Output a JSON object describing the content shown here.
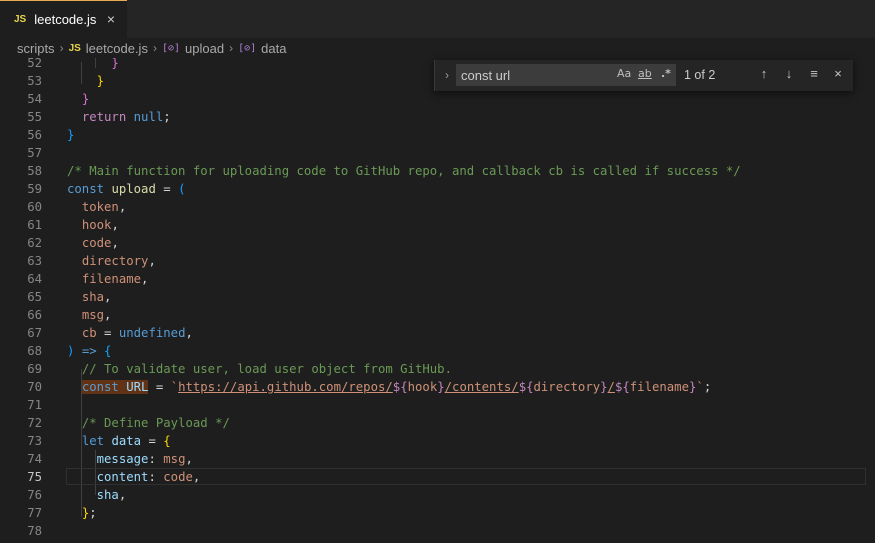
{
  "tab": {
    "badge": "JS",
    "label": "leetcode.js",
    "close": "×"
  },
  "breadcrumb": {
    "folder": "scripts",
    "file_badge": "JS",
    "file": "leetcode.js",
    "sym_icon": "[⊘]",
    "symbol1": "upload",
    "symbol2": "data",
    "sep": "›"
  },
  "find": {
    "toggle": "›",
    "query": "const url",
    "match_case": "Aa",
    "whole_word": "ab",
    "regex": ".*",
    "count": "1 of 2",
    "prev": "↑",
    "next": "↓",
    "selection": "≡",
    "close": "×"
  },
  "editor": {
    "active_line": "75",
    "lines": [
      {
        "n": "52",
        "tokens": [
          {
            "t": "      "
          },
          {
            "t": "}",
            "c": "br2"
          }
        ]
      },
      {
        "n": "53",
        "tokens": [
          {
            "t": "    "
          },
          {
            "t": "}",
            "c": "br1"
          }
        ]
      },
      {
        "n": "54",
        "tokens": [
          {
            "t": "  "
          },
          {
            "t": "}",
            "c": "br2"
          }
        ]
      },
      {
        "n": "55",
        "tokens": [
          {
            "t": "  "
          },
          {
            "t": "return",
            "c": "k"
          },
          {
            "t": " "
          },
          {
            "t": "null",
            "c": "kw"
          },
          {
            "t": ";"
          }
        ]
      },
      {
        "n": "56",
        "tokens": [
          {
            "t": "}",
            "c": "br3"
          }
        ]
      },
      {
        "n": "57",
        "tokens": []
      },
      {
        "n": "58",
        "tokens": [
          {
            "t": "/* Main function for uploading code to GitHub repo, and callback cb is called if success */",
            "c": "c"
          }
        ]
      },
      {
        "n": "59",
        "tokens": [
          {
            "t": "const",
            "c": "kw"
          },
          {
            "t": " "
          },
          {
            "t": "upload",
            "c": "fn"
          },
          {
            "t": " = "
          },
          {
            "t": "(",
            "c": "br3"
          }
        ]
      },
      {
        "n": "60",
        "tokens": [
          {
            "t": "  "
          },
          {
            "t": "token",
            "c": "s"
          },
          {
            "t": ","
          }
        ]
      },
      {
        "n": "61",
        "tokens": [
          {
            "t": "  "
          },
          {
            "t": "hook",
            "c": "s"
          },
          {
            "t": ","
          }
        ]
      },
      {
        "n": "62",
        "tokens": [
          {
            "t": "  "
          },
          {
            "t": "code",
            "c": "s"
          },
          {
            "t": ","
          }
        ]
      },
      {
        "n": "63",
        "tokens": [
          {
            "t": "  "
          },
          {
            "t": "directory",
            "c": "s"
          },
          {
            "t": ","
          }
        ]
      },
      {
        "n": "64",
        "tokens": [
          {
            "t": "  "
          },
          {
            "t": "filename",
            "c": "s"
          },
          {
            "t": ","
          }
        ]
      },
      {
        "n": "65",
        "tokens": [
          {
            "t": "  "
          },
          {
            "t": "sha",
            "c": "s"
          },
          {
            "t": ","
          }
        ]
      },
      {
        "n": "66",
        "tokens": [
          {
            "t": "  "
          },
          {
            "t": "msg",
            "c": "s"
          },
          {
            "t": ","
          }
        ]
      },
      {
        "n": "67",
        "tokens": [
          {
            "t": "  "
          },
          {
            "t": "cb",
            "c": "s"
          },
          {
            "t": " = "
          },
          {
            "t": "undefined",
            "c": "kw"
          },
          {
            "t": ","
          }
        ]
      },
      {
        "n": "68",
        "tokens": [
          {
            "t": ")",
            "c": "br3"
          },
          {
            "t": " "
          },
          {
            "t": "=>",
            "c": "kw"
          },
          {
            "t": " "
          },
          {
            "t": "{",
            "c": "br3"
          }
        ]
      },
      {
        "n": "69",
        "tokens": [
          {
            "t": "  "
          },
          {
            "t": "// To validate user, load user object from GitHub.",
            "c": "c"
          }
        ]
      },
      {
        "n": "70",
        "tokens": [
          {
            "t": "  "
          },
          {
            "t": "const",
            "c": "kw match"
          },
          {
            "t": " ",
            "c": "match"
          },
          {
            "t": "URL",
            "c": "v match"
          },
          {
            "t": " = "
          },
          {
            "t": "`",
            "c": "s"
          },
          {
            "t": "https://api.github.com/repos/",
            "c": "link"
          },
          {
            "t": "${",
            "c": "k"
          },
          {
            "t": "hook",
            "c": "s"
          },
          {
            "t": "}",
            "c": "k"
          },
          {
            "t": "/contents/",
            "c": "link"
          },
          {
            "t": "${",
            "c": "k"
          },
          {
            "t": "directory",
            "c": "s"
          },
          {
            "t": "}",
            "c": "k"
          },
          {
            "t": "/",
            "c": "link"
          },
          {
            "t": "${",
            "c": "k"
          },
          {
            "t": "filename",
            "c": "s"
          },
          {
            "t": "}",
            "c": "k"
          },
          {
            "t": "`",
            "c": "s"
          },
          {
            "t": ";"
          }
        ]
      },
      {
        "n": "71",
        "tokens": []
      },
      {
        "n": "72",
        "tokens": [
          {
            "t": "  "
          },
          {
            "t": "/* Define Payload */",
            "c": "c"
          }
        ]
      },
      {
        "n": "73",
        "tokens": [
          {
            "t": "  "
          },
          {
            "t": "let",
            "c": "kw"
          },
          {
            "t": " "
          },
          {
            "t": "data",
            "c": "v"
          },
          {
            "t": " = "
          },
          {
            "t": "{",
            "c": "br1"
          }
        ]
      },
      {
        "n": "74",
        "tokens": [
          {
            "t": "    "
          },
          {
            "t": "message",
            "c": "v"
          },
          {
            "t": ": "
          },
          {
            "t": "msg",
            "c": "s"
          },
          {
            "t": ","
          }
        ]
      },
      {
        "n": "75",
        "tokens": [
          {
            "t": "    "
          },
          {
            "t": "content",
            "c": "v"
          },
          {
            "t": ": "
          },
          {
            "t": "code",
            "c": "s"
          },
          {
            "t": ","
          }
        ]
      },
      {
        "n": "76",
        "tokens": [
          {
            "t": "    "
          },
          {
            "t": "sha",
            "c": "v"
          },
          {
            "t": ","
          }
        ]
      },
      {
        "n": "77",
        "tokens": [
          {
            "t": "  "
          },
          {
            "t": "}",
            "c": "br1"
          },
          {
            "t": ";"
          }
        ]
      },
      {
        "n": "78",
        "tokens": []
      }
    ]
  }
}
